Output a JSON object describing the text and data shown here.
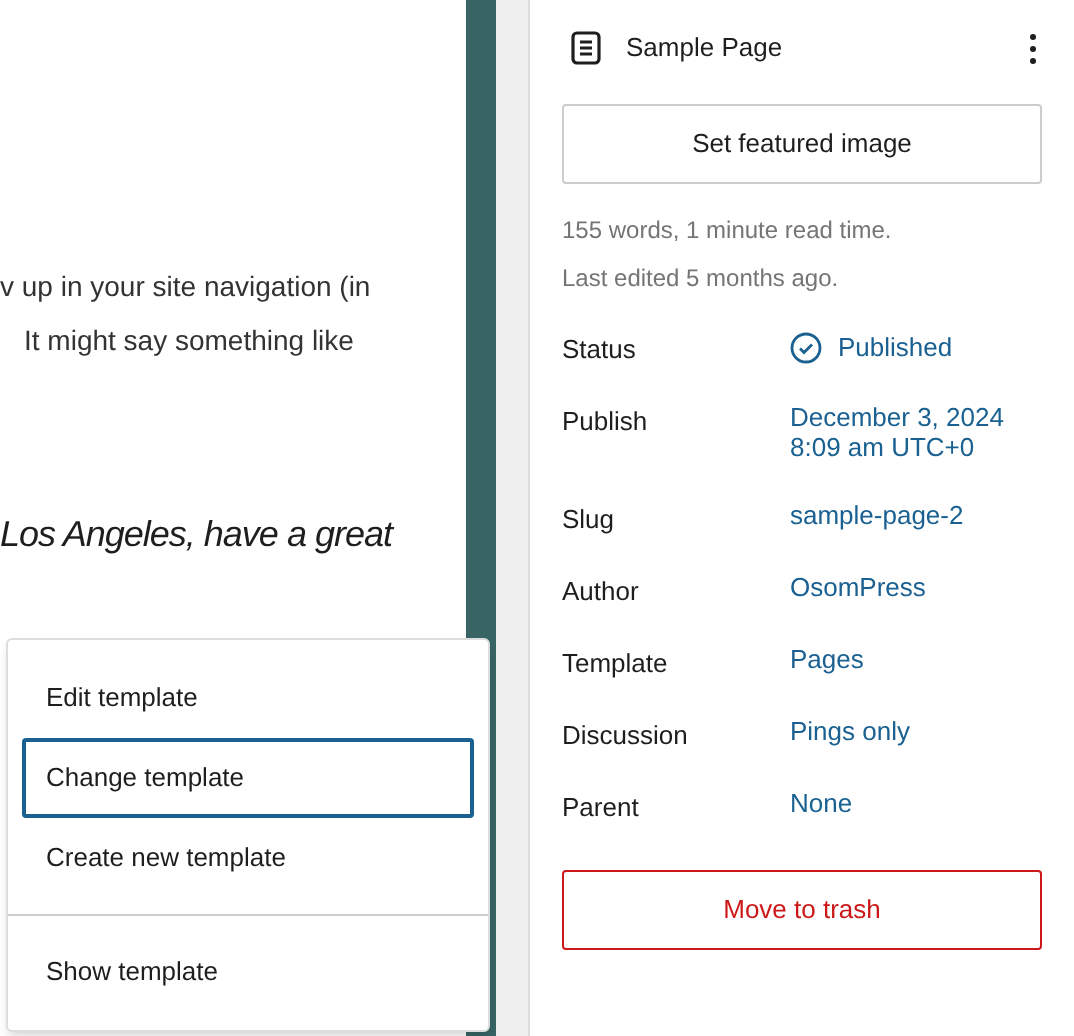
{
  "editor": {
    "lines": [
      {
        "kind": "plain",
        "text": "v up in your site navigation (in"
      },
      {
        "kind": "plain",
        "text": "It might say something like"
      },
      {
        "kind": "quote",
        "text": "Los Angeles, have a great"
      }
    ]
  },
  "template_menu": {
    "sections": [
      {
        "items": [
          {
            "label": "Edit template",
            "selected": false
          },
          {
            "label": "Change template",
            "selected": true
          },
          {
            "label": "Create new template",
            "selected": false
          }
        ]
      },
      {
        "items": [
          {
            "label": "Show template",
            "selected": false
          }
        ]
      }
    ]
  },
  "sidebar": {
    "title": "Sample Page",
    "featured_button": "Set featured image",
    "stats": [
      "155 words, 1 minute read time.",
      "Last edited 5 months ago."
    ],
    "fields": [
      {
        "label": "Status",
        "value": "Published",
        "kind": "status"
      },
      {
        "label": "Publish",
        "value": "December 3, 2024 8:09 am UTC+0",
        "kind": "link"
      },
      {
        "label": "Slug",
        "value": "sample-page-2",
        "kind": "link"
      },
      {
        "label": "Author",
        "value": "OsomPress",
        "kind": "link"
      },
      {
        "label": "Template",
        "value": "Pages",
        "kind": "link"
      },
      {
        "label": "Discussion",
        "value": "Pings only",
        "kind": "link"
      },
      {
        "label": "Parent",
        "value": "None",
        "kind": "link"
      }
    ],
    "trash_button": "Move to trash"
  }
}
